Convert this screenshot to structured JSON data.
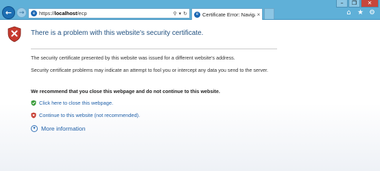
{
  "browser": {
    "address": {
      "prefix": "https://",
      "host": "localhost",
      "path": "/ecp"
    },
    "tab": {
      "label": "Certificate Error: Navigation..."
    },
    "icons": {
      "back": "back-arrow-icon",
      "forward": "forward-arrow-icon",
      "search": "search-icon",
      "refresh": "refresh-icon",
      "home": "home-icon",
      "favorites": "star-icon",
      "settings": "gear-icon"
    }
  },
  "error_page": {
    "title": "There is a problem with this website's security certificate.",
    "paragraph1": "The security certificate presented by this website was issued for a different website's address.",
    "paragraph2": "Security certificate problems may indicate an attempt to fool you or intercept any data you send to the server.",
    "recommendation": "We recommend that you close this webpage and do not continue to this website.",
    "close_link": "Click here to close this webpage.",
    "continue_link": "Continue to this website (not recommended).",
    "more_info": "More information"
  },
  "colors": {
    "chrome": "#5fb0d8",
    "title": "#1f4f7f",
    "link": "#1d5ea7",
    "shield_red": "#c63a2e",
    "shield_green": "#3a9c3a"
  }
}
